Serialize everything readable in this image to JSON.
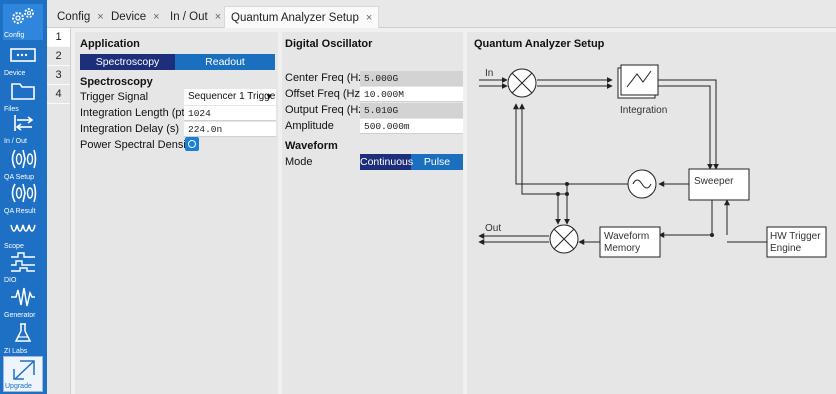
{
  "sidebar": {
    "items": [
      {
        "label": "Config",
        "icon": "gear-icon"
      },
      {
        "label": "Device",
        "icon": "device-icon"
      },
      {
        "label": "Files",
        "icon": "folder-icon"
      },
      {
        "label": "In / Out",
        "icon": "inout-icon"
      },
      {
        "label": "QA Setup",
        "icon": "qa-setup-icon"
      },
      {
        "label": "QA Result",
        "icon": "qa-result-icon"
      },
      {
        "label": "Scope",
        "icon": "scope-icon"
      },
      {
        "label": "DIO",
        "icon": "dio-icon"
      },
      {
        "label": "Generator",
        "icon": "generator-icon"
      },
      {
        "label": "ZI Labs",
        "icon": "flask-icon"
      },
      {
        "label": "Upgrade",
        "icon": "upgrade-icon"
      }
    ]
  },
  "tabs": [
    {
      "label": "Config"
    },
    {
      "label": "Device"
    },
    {
      "label": "In / Out"
    },
    {
      "label": "Quantum Analyzer Setup"
    }
  ],
  "tab_close_glyph": "×",
  "rows": [
    "1",
    "2",
    "3",
    "4"
  ],
  "application": {
    "title": "Application",
    "modes": [
      "Spectroscopy",
      "Readout"
    ],
    "selected_mode": "Spectroscopy"
  },
  "spectroscopy": {
    "title": "Spectroscopy",
    "trigger_signal_label": "Trigger Signal",
    "trigger_signal_value": "Sequencer 1 Trigge",
    "integration_length_label": "Integration Length (pts)",
    "integration_length_value": "1024",
    "integration_delay_label": "Integration Delay (s)",
    "integration_delay_value": "224.0n",
    "psd_label": "Power Spectral Density",
    "psd_enabled": false
  },
  "oscillator": {
    "title": "Digital Oscillator",
    "center_freq_label": "Center Freq (Hz)",
    "center_freq_value": "5.000G",
    "offset_freq_label": "Offset Freq (Hz)",
    "offset_freq_value": "10.000M",
    "output_freq_label": "Output Freq (Hz)",
    "output_freq_value": "5.010G",
    "amplitude_label": "Amplitude",
    "amplitude_value": "500.000m"
  },
  "waveform": {
    "title": "Waveform",
    "mode_label": "Mode",
    "modes": [
      "Continuous",
      "Pulse"
    ],
    "selected_mode": "Continuous"
  },
  "qa_diagram": {
    "title": "Quantum Analyzer Setup",
    "in_label": "In",
    "out_label": "Out",
    "integration_label": "Integration",
    "sweeper_label": "Sweeper",
    "waveform_memory_line1": "Waveform",
    "waveform_memory_line2": "Memory",
    "hw_trigger_line1": "HW Trigger",
    "hw_trigger_line2": "Engine"
  },
  "colors": {
    "accent": "#1a6fbf",
    "selected_segment": "#1d2f7a",
    "sidebar": "#1d70c4"
  }
}
